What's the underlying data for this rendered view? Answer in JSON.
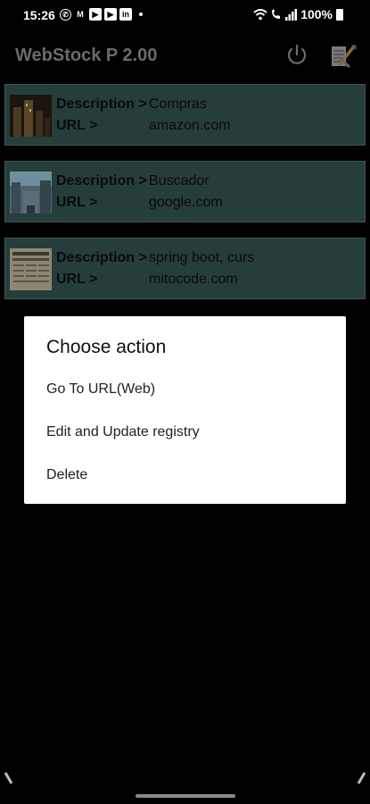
{
  "status_bar": {
    "time": "15:26",
    "left_icons": [
      "whatsapp-icon",
      "gmail-icon",
      "youtube-icon",
      "youtube-icon",
      "linkedin-icon"
    ],
    "battery": "100%"
  },
  "app": {
    "title": "WebStock P 2.00",
    "power_icon": "power-icon",
    "tools_icon": "tools-icon"
  },
  "entries": [
    {
      "desc_label": "Description >",
      "desc_value": "Compras",
      "url_label": "URL >",
      "url_value": "amazon.com"
    },
    {
      "desc_label": "Description >",
      "desc_value": "Buscador",
      "url_label": "URL >",
      "url_value": "google.com"
    },
    {
      "desc_label": "Description >",
      "desc_value": "spring boot, curs",
      "url_label": "URL >",
      "url_value": "mitocode.com"
    }
  ],
  "dialog": {
    "title": "Choose action",
    "items": [
      "Go To URL(Web)",
      "Edit and Update registry",
      "Delete"
    ]
  },
  "colors": {
    "card_bg": "#253e3b",
    "dialog_bg": "#ffffff",
    "title_dim": "#6b6b6b"
  }
}
